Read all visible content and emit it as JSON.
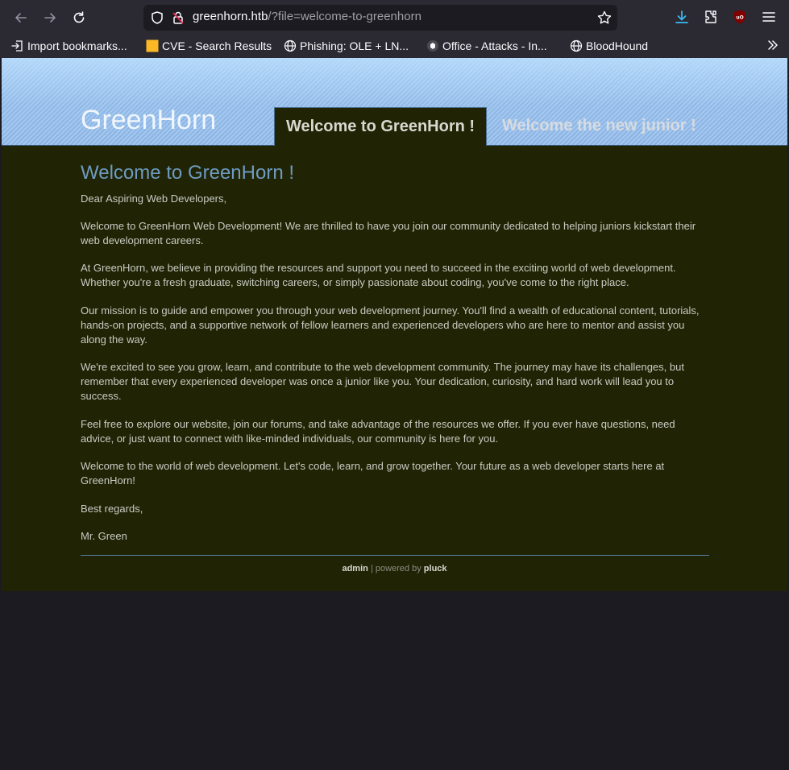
{
  "browser": {
    "url_host": "greenhorn.htb",
    "url_path": "/?file=welcome-to-greenhorn",
    "bookmarks": [
      {
        "label": "Import bookmarks...",
        "icon": "import-icon"
      },
      {
        "label": "CVE - Search Results",
        "icon": "yellow-square-icon"
      },
      {
        "label": "Phishing: OLE + LN...",
        "icon": "globe-icon"
      },
      {
        "label": "Office - Attacks - In...",
        "icon": "hacktricks-icon"
      },
      {
        "label": "BloodHound",
        "icon": "globe-icon"
      }
    ]
  },
  "site": {
    "title": "GreenHorn",
    "tab_active": "Welcome to GreenHorn !",
    "tab_inactive": "Welcome the new junior !"
  },
  "content": {
    "heading": "Welcome to GreenHorn !",
    "paragraphs": [
      "Dear Aspiring Web Developers,",
      "Welcome to GreenHorn Web Development! We are thrilled to have you join our community dedicated to helping juniors kickstart their web development careers.",
      "At GreenHorn, we believe in providing the resources and support you need to succeed in the exciting world of web development. Whether you're a fresh graduate, switching careers, or simply passionate about coding, you've come to the right place.",
      "Our mission is to guide and empower you through your web development journey. You'll find a wealth of educational content, tutorials, hands-on projects, and a supportive network of fellow learners and experienced developers who are here to mentor and assist you along the way.",
      "We're excited to see you grow, learn, and contribute to the web development community. The journey may have its challenges, but remember that every experienced developer was once a junior like you. Your dedication, curiosity, and hard work will lead you to success.",
      "Feel free to explore our website, join our forums, and take advantage of the resources we offer. If you ever have questions, need advice, or just want to connect with like-minded individuals, our community is here for you.",
      "Welcome to the world of web development. Let's code, learn, and grow together. Your future as a web developer starts here at GreenHorn!",
      "Best regards,",
      "Mr. Green"
    ]
  },
  "footer": {
    "admin_label": "admin",
    "separator": "| powered by",
    "pluck_label": "pluck"
  },
  "colors": {
    "content_bg": "#202404",
    "heading": "#6d9bc1",
    "text": "#c9cbc3",
    "header_blue": "#a9cdf2"
  }
}
